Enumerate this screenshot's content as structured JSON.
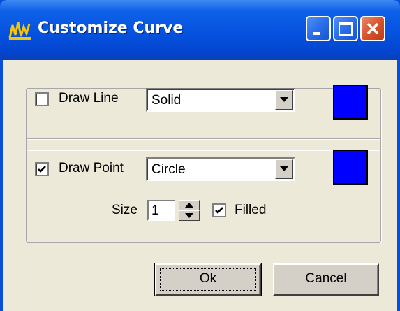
{
  "window": {
    "title": "Customize Curve",
    "title_icon": "chart-app-icon",
    "controls": [
      "minimize-icon",
      "maximize-icon",
      "close-icon"
    ]
  },
  "line_group": {
    "draw_line_checked": false,
    "draw_line_label": "Draw Line",
    "style_value": "Solid",
    "color": "#0000FF"
  },
  "point_group": {
    "draw_point_checked": true,
    "draw_point_label": "Draw Point",
    "shape_value": "Circle",
    "color": "#0000FF",
    "size_label": "Size",
    "size_value": "1",
    "filled_checked": true,
    "filled_label": "Filled"
  },
  "buttons": {
    "ok_label": "Ok",
    "cancel_label": "Cancel"
  }
}
